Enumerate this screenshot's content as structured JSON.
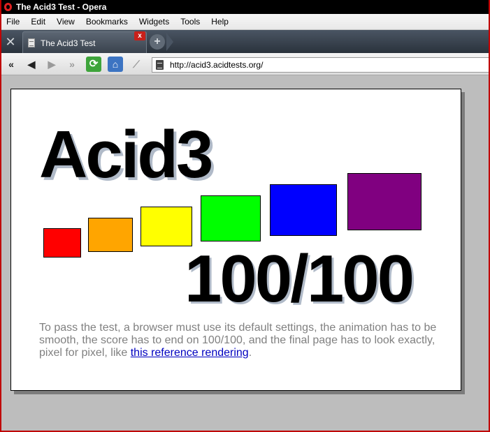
{
  "window": {
    "title": "The Acid3 Test - Opera"
  },
  "menu": {
    "items": [
      "File",
      "Edit",
      "View",
      "Bookmarks",
      "Widgets",
      "Tools",
      "Help"
    ]
  },
  "tabs": {
    "active_title": "The Acid3 Test",
    "close_glyph": "x",
    "new_tab_glyph": "+"
  },
  "nav": {
    "url": "http://acid3.acidtests.org/",
    "buttons": [
      "rewind-icon",
      "back-icon",
      "forward-icon",
      "fast-forward-icon",
      "reload-icon",
      "home-icon",
      "wand-icon"
    ]
  },
  "page": {
    "heading": "Acid3",
    "score": "100/100",
    "boxes": [
      {
        "name": "red-box",
        "color": "#ff0000"
      },
      {
        "name": "orange-box",
        "color": "#ffa500"
      },
      {
        "name": "yellow-box",
        "color": "#ffff00"
      },
      {
        "name": "green-box",
        "color": "#00ff00"
      },
      {
        "name": "blue-box",
        "color": "#0000ff"
      },
      {
        "name": "purple-box",
        "color": "#800080"
      }
    ],
    "description_before_link": "To pass the test, a browser must use its default settings, the animation has to be smooth, the score has to end on 100/100, and the final page has to look exactly, pixel for pixel, like ",
    "link_text": "this reference rendering",
    "description_after_link": "."
  }
}
